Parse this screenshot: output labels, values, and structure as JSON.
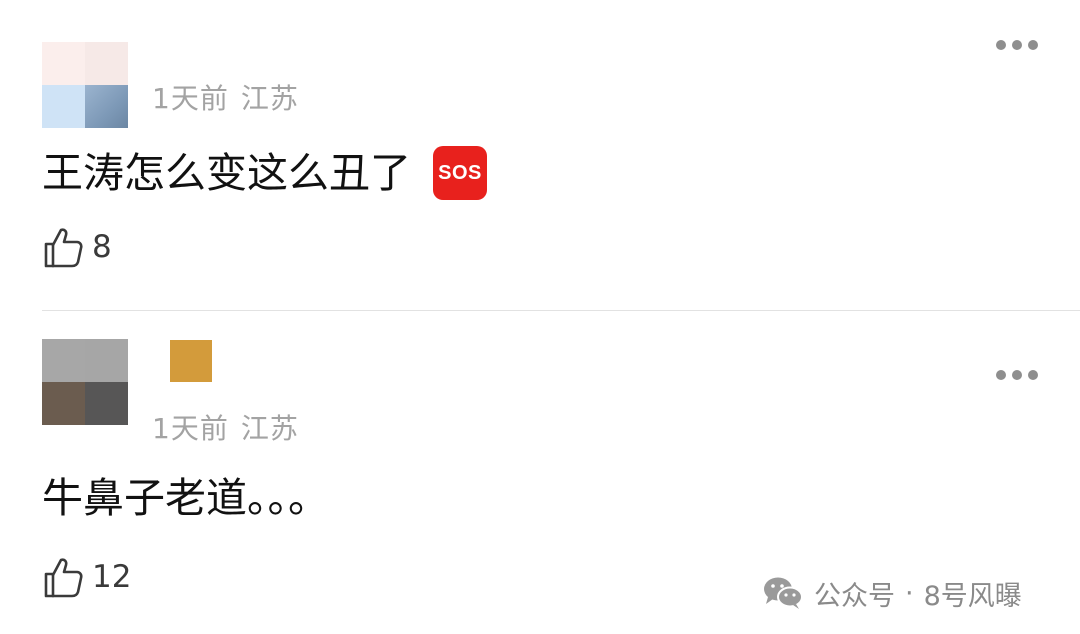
{
  "comments": [
    {
      "time": "1天前",
      "location": "江苏",
      "text": "王涛怎么变这么丑了",
      "emoji_label": "SOS",
      "likes": "8",
      "avatar_colors": [
        "#fbeeec",
        "#f6e9e7",
        "#cfe3f6",
        "#7d99b7"
      ]
    },
    {
      "time": "1天前",
      "location": "江苏",
      "text": "牛鼻子老道。。。",
      "likes": "12",
      "avatar_colors": [
        "#a7a7a7",
        "#a6a6a6",
        "#6b5c4f",
        "#575656"
      ],
      "badge_color": "#d39b3b"
    }
  ],
  "watermark": {
    "icon": "wechat-icon",
    "label": "公众号",
    "separator": "·",
    "account": "8号风曝"
  }
}
